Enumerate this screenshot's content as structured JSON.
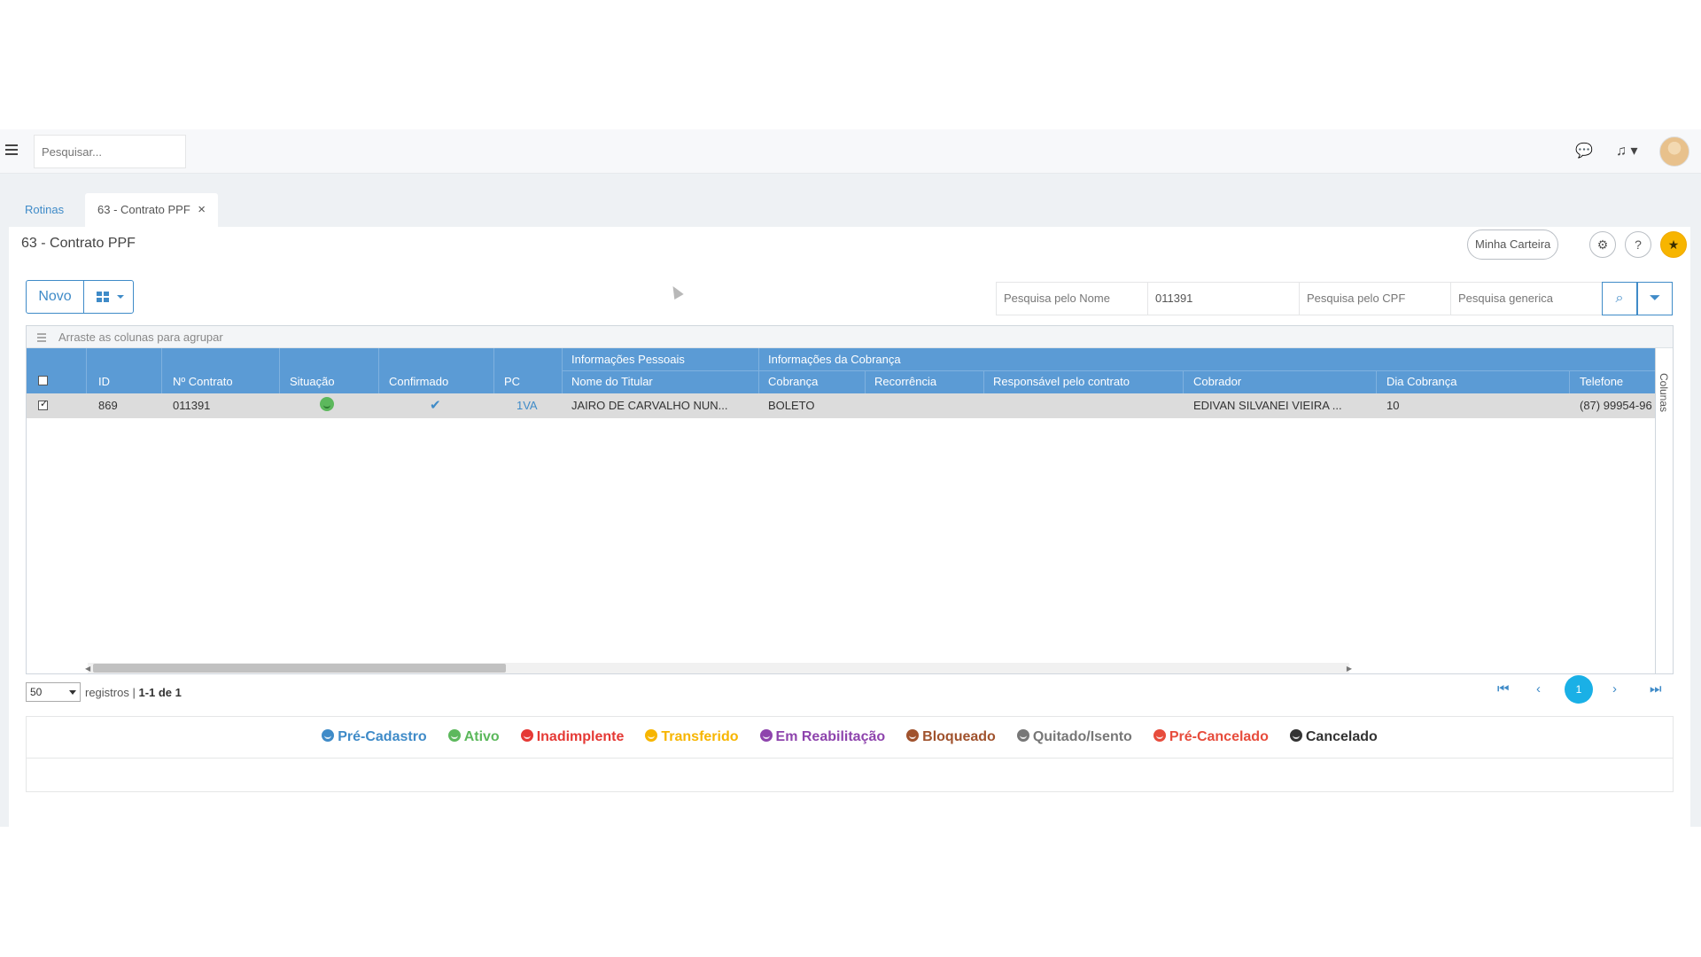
{
  "search": {
    "placeholder": "Pesquisar..."
  },
  "tabs": [
    {
      "label": "Rotinas"
    },
    {
      "label": "63 - Contrato PPF"
    }
  ],
  "page": {
    "title": "63 - Contrato PPF"
  },
  "header_buttons": {
    "minha_carteira": "Minha Carteira"
  },
  "toolbar": {
    "novo_label": "Novo"
  },
  "filters": {
    "nome_placeholder": "Pesquisa pelo Nome",
    "contrato_value": "011391",
    "cpf_placeholder": "Pesquisa pelo CPF",
    "generica_placeholder": "Pesquisa generica"
  },
  "grid": {
    "group_bar": "Arraste as colunas para agrupar",
    "group_headers": [
      "Informações Pessoais",
      "Informações da Cobrança"
    ],
    "columns": [
      "ID",
      "Nº Contrato",
      "Situação",
      "Confirmado",
      "PC",
      "Nome do Titular",
      "Cobrança",
      "Recorrência",
      "Responsável pelo contrato",
      "Cobrador",
      "Dia Cobrança",
      "Telefone"
    ],
    "side_label": "Colunas",
    "rows": [
      {
        "id": "869",
        "contrato": "011391",
        "pc": "1VA",
        "titular": "JAIRO DE CARVALHO NUN...",
        "cobranca": "BOLETO",
        "recorrencia": "",
        "responsavel": "",
        "cobrador": "EDIVAN SILVANEI VIEIRA ...",
        "dia": "10",
        "telefone": "(87) 99954-96"
      }
    ]
  },
  "pagination": {
    "page_size": "50",
    "registros": "registros |",
    "range": "1-1 de 1",
    "current_page": "1"
  },
  "legend": [
    {
      "label": "Pré-Cadastro",
      "color": "#3f8bc8"
    },
    {
      "label": "Ativo",
      "color": "#5cb85c"
    },
    {
      "label": "Inadimplente",
      "color": "#e53935"
    },
    {
      "label": "Transferido",
      "color": "#f7b500"
    },
    {
      "label": "Em Reabilitação",
      "color": "#8e44ad"
    },
    {
      "label": "Bloqueado",
      "color": "#a0522d"
    },
    {
      "label": "Quitado/Isento",
      "color": "#777777"
    },
    {
      "label": "Pré-Cancelado",
      "color": "#e74c3c"
    },
    {
      "label": "Cancelado",
      "color": "#333333"
    }
  ]
}
